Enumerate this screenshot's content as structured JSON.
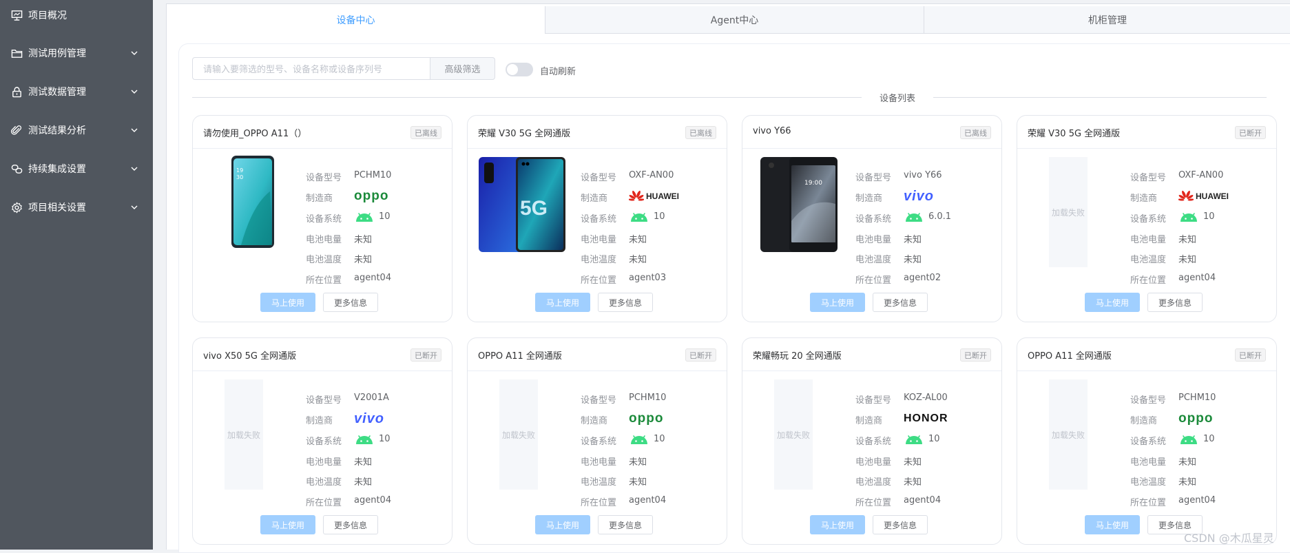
{
  "sidebar": {
    "items": [
      {
        "label": "项目概况",
        "icon": "presentation-icon",
        "has_arrow": false
      },
      {
        "label": "测试用例管理",
        "icon": "folder-icon",
        "has_arrow": true
      },
      {
        "label": "测试数据管理",
        "icon": "lock-icon",
        "has_arrow": true
      },
      {
        "label": "测试结果分析",
        "icon": "paperclip-icon",
        "has_arrow": true
      },
      {
        "label": "持续集成设置",
        "icon": "link-icon",
        "has_arrow": true
      },
      {
        "label": "项目相关设置",
        "icon": "gear-icon",
        "has_arrow": true
      }
    ],
    "colors": {
      "background": "#50565e",
      "text": "#ffffff"
    }
  },
  "tabs": [
    {
      "label": "设备中心",
      "active": true
    },
    {
      "label": "Agent中心",
      "active": false
    },
    {
      "label": "机柜管理",
      "active": false
    }
  ],
  "toolbar": {
    "search_placeholder": "请输入要筛选的型号、设备名称或设备序列号",
    "advanced_filter_label": "高级筛选",
    "auto_refresh_label": "自动刷新",
    "auto_refresh_on": false
  },
  "list_title": "设备列表",
  "spec_labels": {
    "model": "设备型号",
    "manufacturer": "制造商",
    "os": "设备系统",
    "battery_level": "电池电量",
    "battery_temp": "电池温度",
    "location": "所在位置"
  },
  "buttons": {
    "use": "马上使用",
    "more": "更多信息"
  },
  "image_failed_text": "加载失败",
  "devices": [
    {
      "name": "请勿使用_OPPO A11（）",
      "status": "已离线",
      "model": "PCHM10",
      "manufacturer": "OPPO",
      "manufacturer_logo": "oppo",
      "os": "10",
      "battery_level": "未知",
      "battery_temp": "未知",
      "location": "agent04",
      "image": "phone-oppo"
    },
    {
      "name": "荣耀 V30 5G 全网通版",
      "status": "已离线",
      "model": "OXF-AN00",
      "manufacturer": "HUAWEI",
      "manufacturer_logo": "huawei",
      "os": "10",
      "battery_level": "未知",
      "battery_temp": "未知",
      "location": "agent03",
      "image": "phone-honor"
    },
    {
      "name": "vivo Y66",
      "status": "已离线",
      "model": "vivo Y66",
      "manufacturer": "vivo",
      "manufacturer_logo": "vivo",
      "os": "6.0.1",
      "battery_level": "未知",
      "battery_temp": "未知",
      "location": "agent02",
      "image": "phone-vivo"
    },
    {
      "name": "荣耀 V30 5G 全网通版",
      "status": "已断开",
      "model": "OXF-AN00",
      "manufacturer": "HUAWEI",
      "manufacturer_logo": "huawei",
      "os": "10",
      "battery_level": "未知",
      "battery_temp": "未知",
      "location": "agent04",
      "image": "failed"
    },
    {
      "name": "vivo X50 5G 全网通版",
      "status": "已断开",
      "model": "V2001A",
      "manufacturer": "vivo",
      "manufacturer_logo": "vivo",
      "os": "10",
      "battery_level": "未知",
      "battery_temp": "未知",
      "location": "agent04",
      "image": "failed"
    },
    {
      "name": "OPPO A11 全网通版",
      "status": "已断开",
      "model": "PCHM10",
      "manufacturer": "OPPO",
      "manufacturer_logo": "oppo",
      "os": "10",
      "battery_level": "未知",
      "battery_temp": "未知",
      "location": "agent04",
      "image": "failed"
    },
    {
      "name": "荣耀畅玩 20 全网通版",
      "status": "已断开",
      "model": "KOZ-AL00",
      "manufacturer": "HONOR",
      "manufacturer_logo": "honor",
      "os": "10",
      "battery_level": "未知",
      "battery_temp": "未知",
      "location": "agent04",
      "image": "failed"
    },
    {
      "name": "OPPO A11 全网通版",
      "status": "已断开",
      "model": "PCHM10",
      "manufacturer": "OPPO",
      "manufacturer_logo": "oppo",
      "os": "10",
      "battery_level": "未知",
      "battery_temp": "未知",
      "location": "agent04",
      "image": "failed"
    }
  ],
  "watermark": "CSDN @木瓜星灵",
  "colors": {
    "accent": "#409eff",
    "use_button": "#a0cfff",
    "oppo": "#1b8a3a",
    "vivo": "#415fff",
    "huawei_red": "#e1261c",
    "android_green": "#3ddc84"
  }
}
